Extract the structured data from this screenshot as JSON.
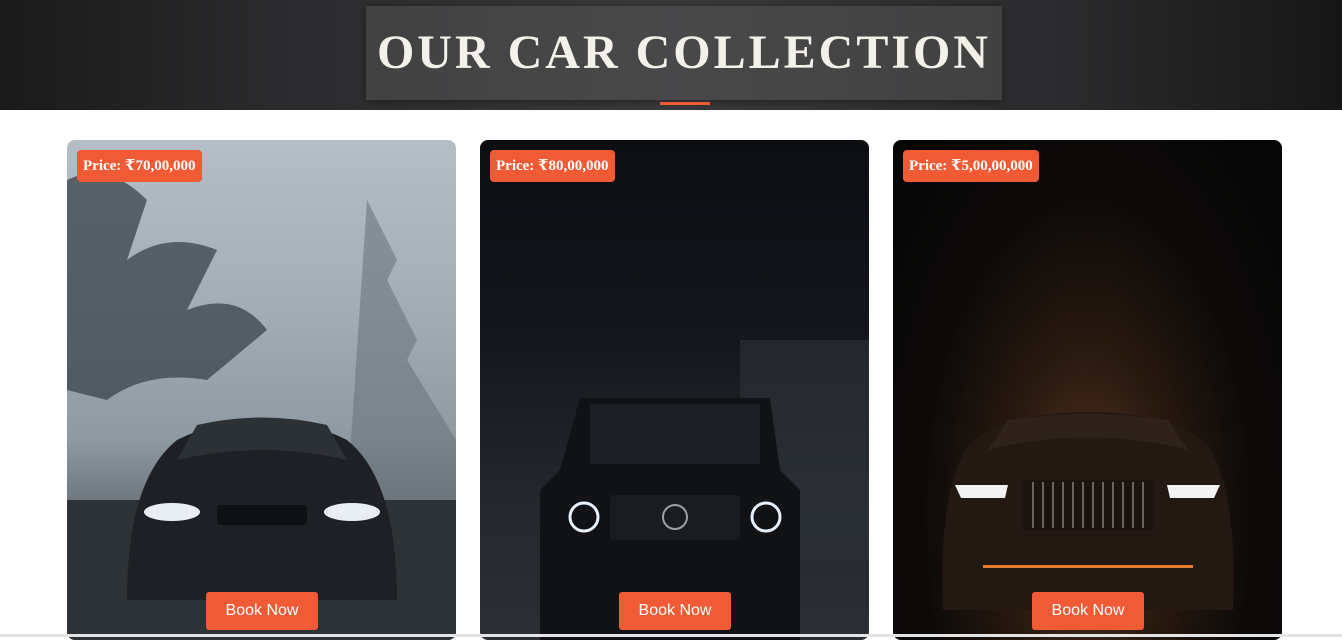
{
  "header": {
    "title": "OUR CAR COLLECTION"
  },
  "cars": [
    {
      "price": "Price: ₹70,00,000",
      "button_label": "Book Now"
    },
    {
      "price": "Price: ₹80,00,000",
      "button_label": "Book Now"
    },
    {
      "price": "Price: ₹5,00,00,000",
      "button_label": "Book Now"
    }
  ],
  "colors": {
    "accent": "#f05a35",
    "header_bg": "#2a2a2c",
    "title_text": "#f4f1ea"
  }
}
